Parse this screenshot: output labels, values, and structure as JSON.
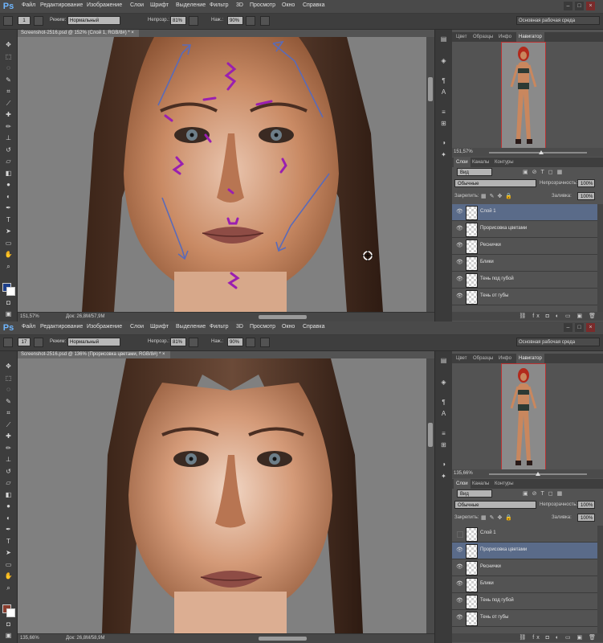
{
  "screens": [
    {
      "menu": [
        "Файл",
        "Редактирование",
        "Изображение",
        "Слои",
        "Шрифт",
        "Выделение",
        "Фильтр",
        "3D",
        "Просмотр",
        "Окно",
        "Справка"
      ],
      "options": {
        "brush_size": "1",
        "mode_label": "Режим:",
        "mode_value": "Нормальный",
        "opacity_label": "Непрозр.:",
        "opacity_value": "81%",
        "flow_label": "Наж.:",
        "flow_value": "90%",
        "workspace": "Основная рабочая среда"
      },
      "doc_tab": "Screenshot-2516.psd @ 152% (Слой 1, RGB/8#) * ×",
      "status": {
        "zoom": "151,57%",
        "doc": "Док: 26,8M/57,9M"
      },
      "panel_tabs": [
        "Цвет",
        "Образцы",
        "Инфо",
        "Навигатор"
      ],
      "nav_zoom": "151,57%",
      "layer_tabs": [
        "Слои",
        "Каналы",
        "Контуры"
      ],
      "layers_panel": {
        "kind": "Вид",
        "blend": "Обычные",
        "opacity_label": "Непрозрачность:",
        "opacity": "100%",
        "lock_label": "Закрепить:",
        "fill_label": "Заливка:",
        "fill": "100%"
      },
      "layers": [
        {
          "name": "Слой 1",
          "visible": true,
          "active": true
        },
        {
          "name": "Прорисовка цветами",
          "visible": true,
          "active": false
        },
        {
          "name": "Реснички",
          "visible": true,
          "active": false
        },
        {
          "name": "Блики",
          "visible": true,
          "active": false
        },
        {
          "name": "Тень под губой",
          "visible": true,
          "active": false
        },
        {
          "name": "Тень от губы",
          "visible": true,
          "active": false
        }
      ]
    },
    {
      "menu": [
        "Файл",
        "Редактирование",
        "Изображение",
        "Слои",
        "Шрифт",
        "Выделение",
        "Фильтр",
        "3D",
        "Просмотр",
        "Окно",
        "Справка"
      ],
      "options": {
        "brush_size": "17",
        "mode_label": "Режим:",
        "mode_value": "Нормальный",
        "opacity_label": "Непрозр.:",
        "opacity_value": "81%",
        "flow_label": "Наж.:",
        "flow_value": "90%",
        "workspace": "Основная рабочая среда"
      },
      "doc_tab": "Screenshot-2516.psd @ 136% (Прорисовка цветами, RGB/8#) * ×",
      "status": {
        "zoom": "135,66%",
        "doc": "Док: 26,8M/58,9M"
      },
      "panel_tabs": [
        "Цвет",
        "Образцы",
        "Инфо",
        "Навигатор"
      ],
      "nav_zoom": "135,66%",
      "layer_tabs": [
        "Слои",
        "Каналы",
        "Контуры"
      ],
      "layers_panel": {
        "kind": "Вид",
        "blend": "Обычные",
        "opacity_label": "Непрозрачность:",
        "opacity": "100%",
        "lock_label": "Закрепить:",
        "fill_label": "Заливка:",
        "fill": "100%"
      },
      "layers": [
        {
          "name": "Слой 1",
          "visible": false,
          "active": false
        },
        {
          "name": "Прорисовка цветами",
          "visible": true,
          "active": true
        },
        {
          "name": "Реснички",
          "visible": true,
          "active": false
        },
        {
          "name": "Блики",
          "visible": true,
          "active": false
        },
        {
          "name": "Тень под губой",
          "visible": true,
          "active": false
        },
        {
          "name": "Тень от губы",
          "visible": true,
          "active": false
        }
      ]
    }
  ],
  "colors": {
    "fg_top": "#1d3f8a",
    "fg_bottom": "#8a3d2e",
    "active_layer": "#5a6b89",
    "ps_logo": "#6fb6ff",
    "marks_purple": "#9a1fb0",
    "arrows_blue": "#5a6bb8"
  }
}
